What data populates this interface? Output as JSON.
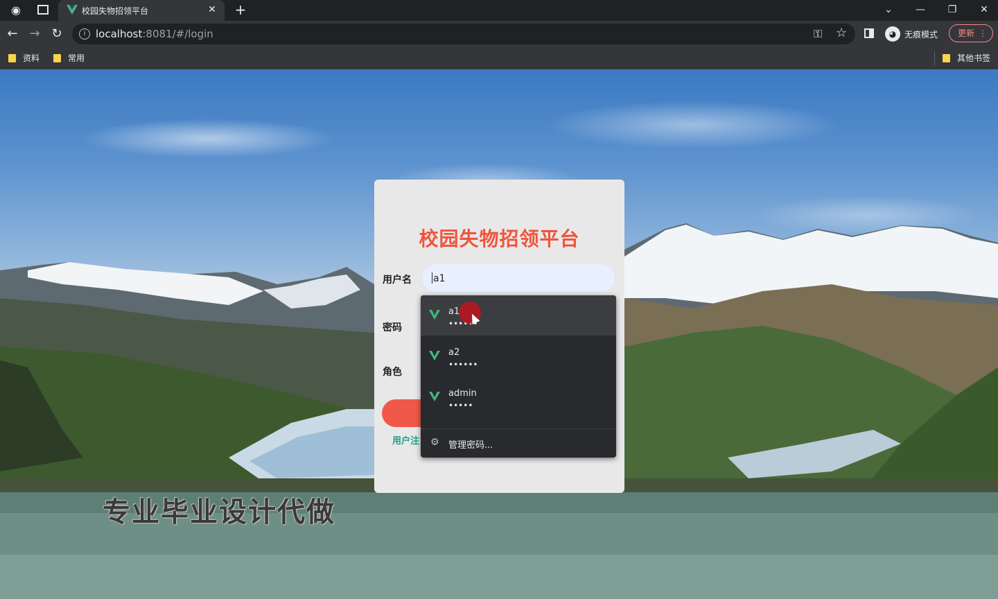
{
  "browser": {
    "tab_title": "校园失物招领平台",
    "tab_close": "✕",
    "new_tab": "+",
    "window_controls": {
      "dropdown": "⌄",
      "minimize": "—",
      "restore": "❐",
      "close": "✕"
    },
    "url_host": "localhost",
    "url_rest": ":8081/#/login",
    "incognito_label": "无痕模式",
    "update_label": "更新",
    "update_menu": "⋮",
    "bookmarks": [
      {
        "label": "资料"
      },
      {
        "label": "常用"
      }
    ],
    "other_bookmarks": "其他书签",
    "icons": [
      "incognito-globe-icon",
      "tab-strip-icon",
      "back-icon",
      "forward-icon",
      "reload-icon",
      "info-icon",
      "key-icon",
      "star-icon",
      "side-panel-icon",
      "incognito-icon",
      "vue-logo-icon",
      "folder-icon"
    ]
  },
  "login": {
    "title": "校园失物招领平台",
    "username_label": "用户名",
    "username_value": "a1",
    "password_label": "密码",
    "role_label": "角色",
    "register_link": "用户注"
  },
  "autofill": {
    "items": [
      {
        "username": "a1",
        "masked": "••••••"
      },
      {
        "username": "a2",
        "masked": "••••••"
      },
      {
        "username": "admin",
        "masked": "•••••"
      }
    ],
    "manage_label": "管理密码...",
    "hovered_index": 0
  },
  "watermark": "专业毕业设计代做",
  "colors": {
    "title_red": "#f0553c",
    "button_red": "#f0594a",
    "link_teal": "#1e9e8e",
    "vue_green": "#41b883"
  }
}
